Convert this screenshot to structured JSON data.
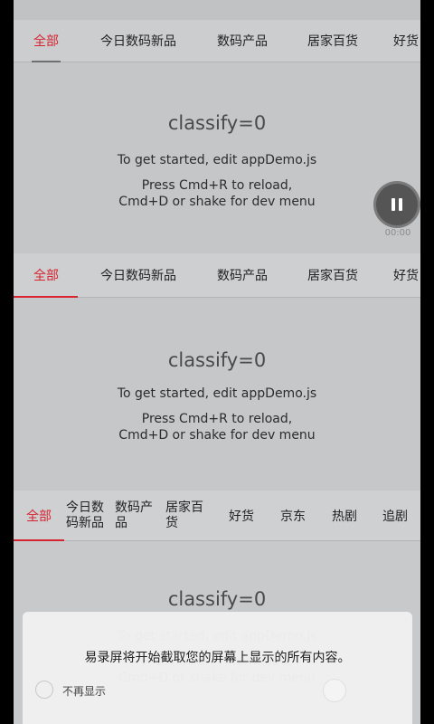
{
  "tabs": [
    "全部",
    "今日数码新品",
    "数码产品",
    "居家百货",
    "好货",
    "京东",
    "热剧",
    "追剧"
  ],
  "content": {
    "welcome": "classify=0",
    "instructions_1": "To get started, edit appDemo.js",
    "instructions_2": "Press Cmd+R to reload,",
    "instructions_3": "Cmd+D or shake for dev menu"
  },
  "recorder": {
    "timer": "00:00",
    "pause_icon": "pause-icon"
  },
  "dialog": {
    "message": "易录屏将开始截取您的屏幕上显示的所有内容。",
    "checkbox_label": "不再显示"
  },
  "colors": {
    "accent": "#d62430",
    "background": "#c6c7c9",
    "text": "#222222"
  }
}
